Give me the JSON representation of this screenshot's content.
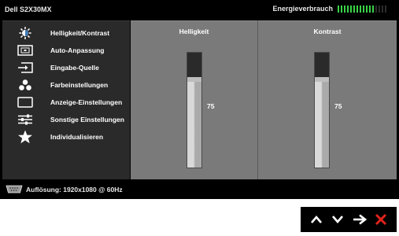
{
  "header": {
    "model": "Dell S2X30MX",
    "energy_label": "Energieverbrauch",
    "energy_level": 0.75
  },
  "menu": {
    "items": [
      {
        "label": "Helligkeit/Kontrast",
        "icon": "brightness-icon",
        "active": true
      },
      {
        "label": "Auto-Anpassung",
        "icon": "auto-adjust-icon",
        "active": false
      },
      {
        "label": "Eingabe-Quelle",
        "icon": "input-source-icon",
        "active": false
      },
      {
        "label": "Farbeinstellungen",
        "icon": "color-settings-icon",
        "active": false
      },
      {
        "label": "Anzeige-Einstellungen",
        "icon": "display-settings-icon",
        "active": false
      },
      {
        "label": "Sonstige Einstellungen",
        "icon": "other-settings-icon",
        "active": false
      },
      {
        "label": "Individualisieren",
        "icon": "star-icon",
        "active": false
      }
    ]
  },
  "brightness": {
    "title": "Helligkeit",
    "value": "75",
    "level": 0.75
  },
  "contrast": {
    "title": "Kontrast",
    "value": "75",
    "level": 0.75
  },
  "status": {
    "resolution_text": "Auflösung: 1920x1080 @ 60Hz"
  },
  "nav": [
    "up-arrow-icon",
    "down-arrow-icon",
    "right-arrow-icon",
    "close-icon"
  ],
  "colors": {
    "active_item": "#3f7bb6",
    "panel": "#7a7a7a",
    "sidebar": "#2a2a2a",
    "energy_on": "#39d447",
    "close": "#e2231a"
  }
}
